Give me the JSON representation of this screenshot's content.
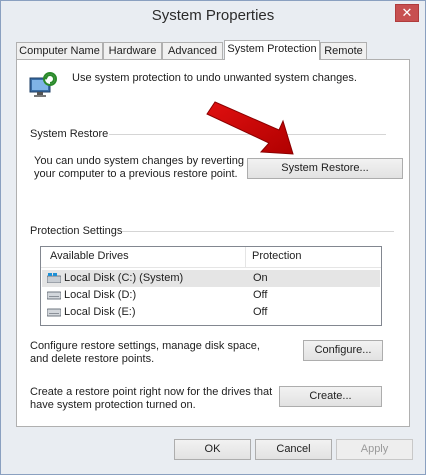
{
  "window": {
    "title": "System Properties",
    "close_glyph": "✕",
    "accent": "#c75050"
  },
  "tabs": [
    {
      "label": "Computer Name",
      "active": false
    },
    {
      "label": "Hardware",
      "active": false
    },
    {
      "label": "Advanced",
      "active": false
    },
    {
      "label": "System Protection",
      "active": true
    },
    {
      "label": "Remote",
      "active": false
    }
  ],
  "intro": {
    "icon": "system-protection-icon",
    "text": "Use system protection to undo unwanted system changes."
  },
  "system_restore": {
    "heading": "System Restore",
    "description_line1": "You can undo system changes by reverting",
    "description_line2": "your computer to a previous restore point.",
    "button": "System Restore...",
    "annotation": "red-arrow-icon"
  },
  "protection_settings": {
    "heading": "Protection Settings",
    "columns": [
      "Available Drives",
      "Protection"
    ],
    "drives": [
      {
        "name": "Local Disk (C:) (System)",
        "protection": "On",
        "icon": "system-drive-icon",
        "selected": true
      },
      {
        "name": "Local Disk (D:)",
        "protection": "Off",
        "icon": "drive-icon",
        "selected": false
      },
      {
        "name": "Local Disk (E:)",
        "protection": "Off",
        "icon": "drive-icon",
        "selected": false
      }
    ]
  },
  "configure": {
    "line1": "Configure restore settings, manage disk space,",
    "line2": "and delete restore points.",
    "button": "Configure..."
  },
  "create": {
    "line1": "Create a restore point right now for the drives that",
    "line2": "have system protection turned on.",
    "button": "Create..."
  },
  "footer": {
    "ok": "OK",
    "cancel": "Cancel",
    "apply": "Apply"
  }
}
